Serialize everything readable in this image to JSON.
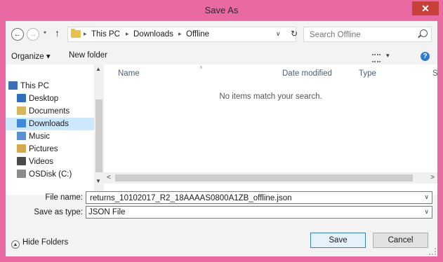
{
  "window": {
    "title": "Save As",
    "close_glyph": "✕"
  },
  "address": {
    "back_glyph": "←",
    "forward_glyph": "→",
    "recent_glyph": "▾",
    "up_glyph": "↑",
    "sep_glyph": "▸",
    "crumbs": [
      "This PC",
      "Downloads",
      "Offline"
    ],
    "dropdown_glyph": "∨",
    "refresh_glyph": "↻"
  },
  "search": {
    "placeholder": "Search Offline",
    "icon": "search-icon"
  },
  "toolbar": {
    "organize_label": "Organize ▾",
    "new_folder_label": "New folder",
    "view_dropdown_glyph": "▾",
    "help_glyph": "?"
  },
  "nav": {
    "items": [
      {
        "label": "This PC",
        "icon": "computer-icon"
      },
      {
        "label": "Desktop",
        "icon": "desktop-folder-icon"
      },
      {
        "label": "Documents",
        "icon": "documents-folder-icon"
      },
      {
        "label": "Downloads",
        "icon": "downloads-folder-icon",
        "selected": true
      },
      {
        "label": "Music",
        "icon": "music-folder-icon"
      },
      {
        "label": "Pictures",
        "icon": "pictures-folder-icon"
      },
      {
        "label": "Videos",
        "icon": "videos-folder-icon"
      },
      {
        "label": "OSDisk (C:)",
        "icon": "disk-drive-icon"
      }
    ],
    "scroll_up_glyph": "▲",
    "scroll_down_glyph": "▼"
  },
  "columns": {
    "name": "Name",
    "date_modified": "Date modified",
    "type": "Type",
    "size": "Si"
  },
  "content": {
    "empty_message": "No items match your search.",
    "sort_glyph": "˄"
  },
  "hscroll": {
    "left_glyph": "<",
    "right_glyph": ">"
  },
  "form": {
    "file_name_label": "File name:",
    "file_name_value": "returns_10102017_R2_18AAAAS0800A1ZB_offline.json",
    "save_type_label": "Save as type:",
    "save_type_value": "JSON File",
    "dropdown_glyph": "∨"
  },
  "bottom": {
    "hide_folders_label": "Hide Folders",
    "hide_folders_glyph": "▲",
    "save_label": "Save",
    "cancel_label": "Cancel"
  },
  "colors": {
    "accent": "#e96aa3",
    "close": "#c7413a",
    "selection": "#cce8ff",
    "help": "#2f7bd1"
  }
}
